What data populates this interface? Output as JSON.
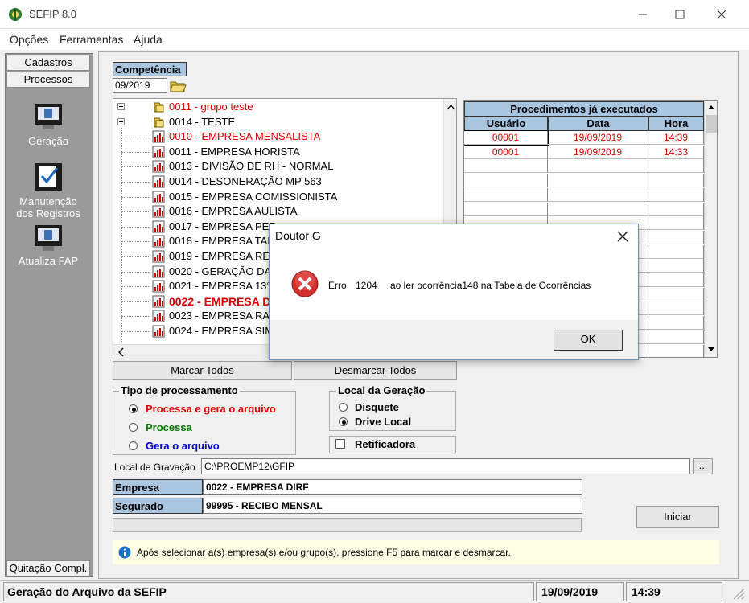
{
  "window": {
    "title": "SEFIP 8.0"
  },
  "menu": [
    "Opções",
    "Ferramentas",
    "Ajuda"
  ],
  "sidebar": {
    "tabs": [
      "Cadastros",
      "Processos"
    ],
    "items": [
      {
        "label": "Geração"
      },
      {
        "label": "Manutenção dos Registros"
      },
      {
        "label": "Atualiza FAP"
      }
    ],
    "bottom_button": "Quitação Compl."
  },
  "competencia": {
    "label": "Competência",
    "value": "09/2019"
  },
  "tree": {
    "rows": [
      {
        "code": "0011 - grupo teste",
        "type": "group",
        "color": "red"
      },
      {
        "code": "0014 - TESTE",
        "type": "group",
        "color": "black"
      },
      {
        "code": "0010 - EMPRESA MENSALISTA",
        "type": "company",
        "color": "red"
      },
      {
        "code": "0011 - EMPRESA HORISTA",
        "type": "company",
        "color": "black"
      },
      {
        "code": "0013 - DIVISÃO DE RH - NORMAL",
        "type": "company",
        "color": "black"
      },
      {
        "code": "0014 - DESONERAÇÃO MP 563",
        "type": "company",
        "color": "black"
      },
      {
        "code": "0015 - EMPRESA COMISSIONISTA",
        "type": "company",
        "color": "black"
      },
      {
        "code": "0016 - EMPRESA AULISTA",
        "type": "company",
        "color": "black"
      },
      {
        "code": "0017 - EMPRESA PER",
        "type": "company",
        "color": "black"
      },
      {
        "code": "0018 - EMPRESA TAF",
        "type": "company",
        "color": "black"
      },
      {
        "code": "0019 - EMPRESA REC",
        "type": "company",
        "color": "black"
      },
      {
        "code": "0020 - GERAÇÃO DA",
        "type": "company",
        "color": "black"
      },
      {
        "code": "0021 - EMPRESA 13°",
        "type": "company",
        "color": "black"
      },
      {
        "code": "0022 - EMPRESA D",
        "type": "company",
        "color": "red",
        "bold": true
      },
      {
        "code": "0023 - EMPRESA RAI",
        "type": "company",
        "color": "black"
      },
      {
        "code": "0024 - EMPRESA SIM",
        "type": "company",
        "color": "black"
      }
    ]
  },
  "procedimentos": {
    "title": "Procedimentos já executados",
    "columns": [
      "Usuário",
      "Data",
      "Hora"
    ],
    "rows": [
      [
        "00001",
        "19/09/2019",
        "14:39"
      ],
      [
        "00001",
        "19/09/2019",
        "14:33"
      ]
    ]
  },
  "buttons": {
    "marcar": "Marcar Todos",
    "desmarcar": "Desmarcar Todos",
    "iniciar": "Iniciar",
    "browse": "..."
  },
  "tipo": {
    "legend": "Tipo de processamento",
    "options": [
      {
        "label": "Processa e gera o arquivo",
        "color": "#e00000",
        "selected": true
      },
      {
        "label": "Processa",
        "color": "#007a00",
        "selected": false
      },
      {
        "label": "Gera o arquivo",
        "color": "#0000cc",
        "selected": false
      }
    ]
  },
  "local": {
    "legend": "Local da Geração",
    "options": [
      {
        "label": "Disquete",
        "selected": false
      },
      {
        "label": "Drive Local",
        "selected": true
      }
    ]
  },
  "retificadora": {
    "label": "Retificadora",
    "checked": false
  },
  "gravacao": {
    "label": "Local de Gravação",
    "value": "C:\\PROEMP12\\GFIP"
  },
  "empresa": {
    "label": "Empresa",
    "value": "0022 - EMPRESA DIRF"
  },
  "segurado": {
    "label": "Segurado",
    "value": "99995 - RECIBO MENSAL"
  },
  "info": "Após selecionar a(s) empresa(s) e/ou grupo(s), pressione F5 para marcar e desmarcar.",
  "status": {
    "text": "Geração do Arquivo da SEFIP",
    "date": "19/09/2019",
    "time": "14:39"
  },
  "dialog": {
    "title": "Doutor G",
    "message_prefix": "Erro",
    "code": "1204",
    "message": "ao ler ocorrência148 na Tabela de Ocorrências",
    "ok": "OK"
  },
  "colors": {
    "header_blue": "#a9c6e0",
    "error_red": "#e00000",
    "info_bg": "#ffffe6"
  }
}
